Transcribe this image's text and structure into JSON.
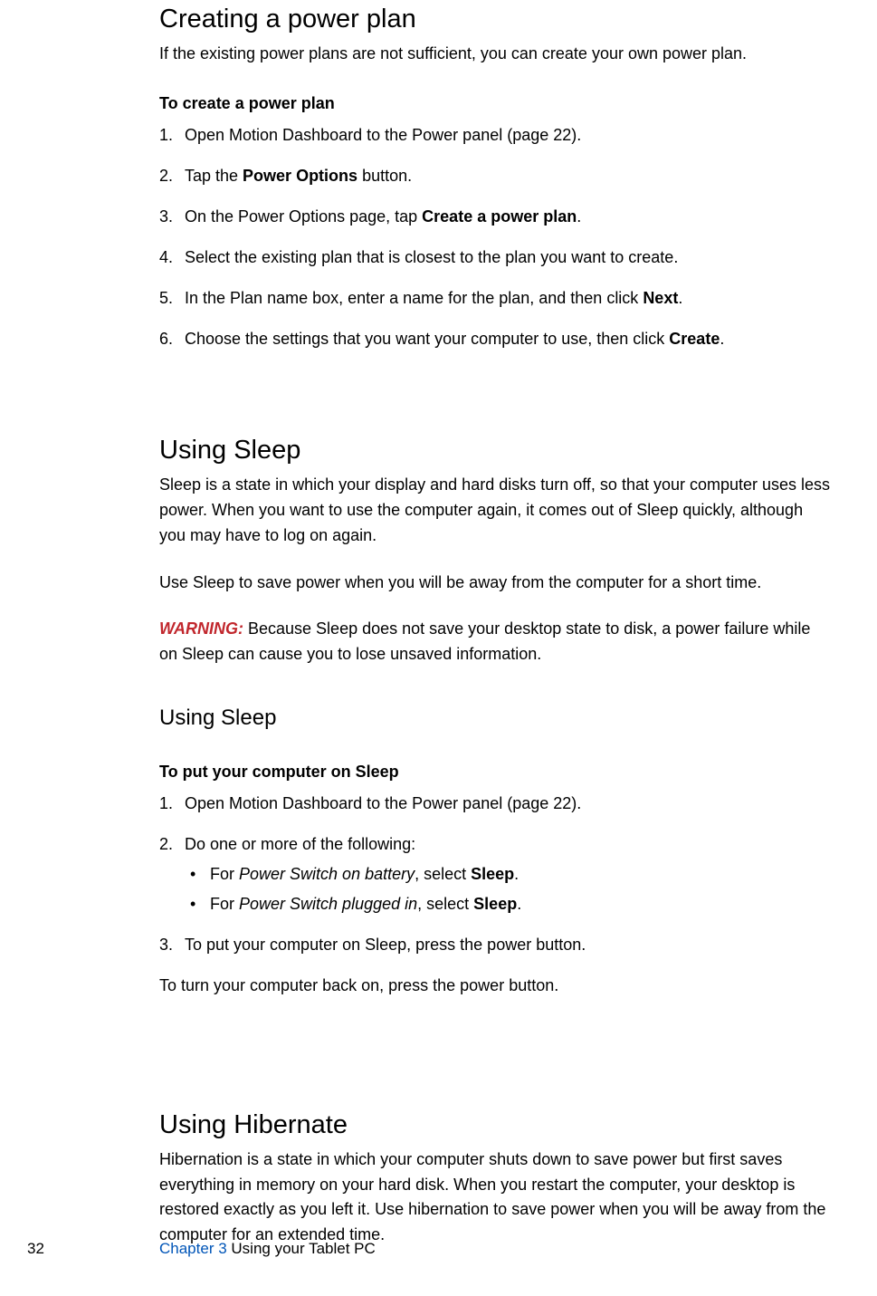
{
  "section1": {
    "title": "Creating a power plan",
    "intro": "If the existing power plans are not sufficient, you can create your own power plan.",
    "proc_title": "To create a power plan",
    "steps": {
      "s1": "Open Motion Dashboard to the Power panel (page 22).",
      "s2a": "Tap the ",
      "s2b": "Power Options",
      "s2c": " button.",
      "s3a": "On the Power Options page, tap ",
      "s3b": "Create a power plan",
      "s3c": ".",
      "s4": "Select the existing plan that is closest to the plan you want to create.",
      "s5a": "In the Plan name box, enter a name for the plan, and then click ",
      "s5b": "Next",
      "s5c": ".",
      "s6a": "Choose the settings that you want your computer to use, then click ",
      "s6b": "Create",
      "s6c": "."
    }
  },
  "section2": {
    "title": "Using Sleep",
    "intro": "Sleep is a state in which your display and hard disks turn off, so that your computer uses less power. When you want to use the computer again, it comes out of Sleep quickly, although you may have to log on again.",
    "body2": "Use Sleep to save power when you will be away from the computer for a short time.",
    "warn_label": "WARNING:",
    "warn_text": " Because Sleep does not save your desktop state to disk, a power failure while on Sleep can cause you to lose unsaved information.",
    "sub_heading": "Using Sleep",
    "proc_title": "To put your computer on Sleep",
    "steps": {
      "s1": "Open Motion Dashboard to the Power panel (page 22).",
      "s2": "Do one or more of the following:",
      "b1a": "For ",
      "b1b": "Power Switch on battery",
      "b1c": ", select ",
      "b1d": "Sleep",
      "b1e": ".",
      "b2a": "For ",
      "b2b": "Power Switch plugged in",
      "b2c": ", select ",
      "b2d": "Sleep",
      "b2e": ".",
      "s3": "To put your computer on Sleep, press the power button."
    },
    "after": "To turn your computer back on, press the power button."
  },
  "section3": {
    "title": "Using Hibernate",
    "intro": "Hibernation is a state in which your computer shuts down to save power but first saves everything in memory on your hard disk. When you restart the computer, your desktop is restored exactly as you left it. Use hibernation to save power when you will be away from the computer for an extended time."
  },
  "footer": {
    "page_num": "32",
    "chapter": "Chapter 3  ",
    "chapter_title": "Using your Tablet PC"
  }
}
